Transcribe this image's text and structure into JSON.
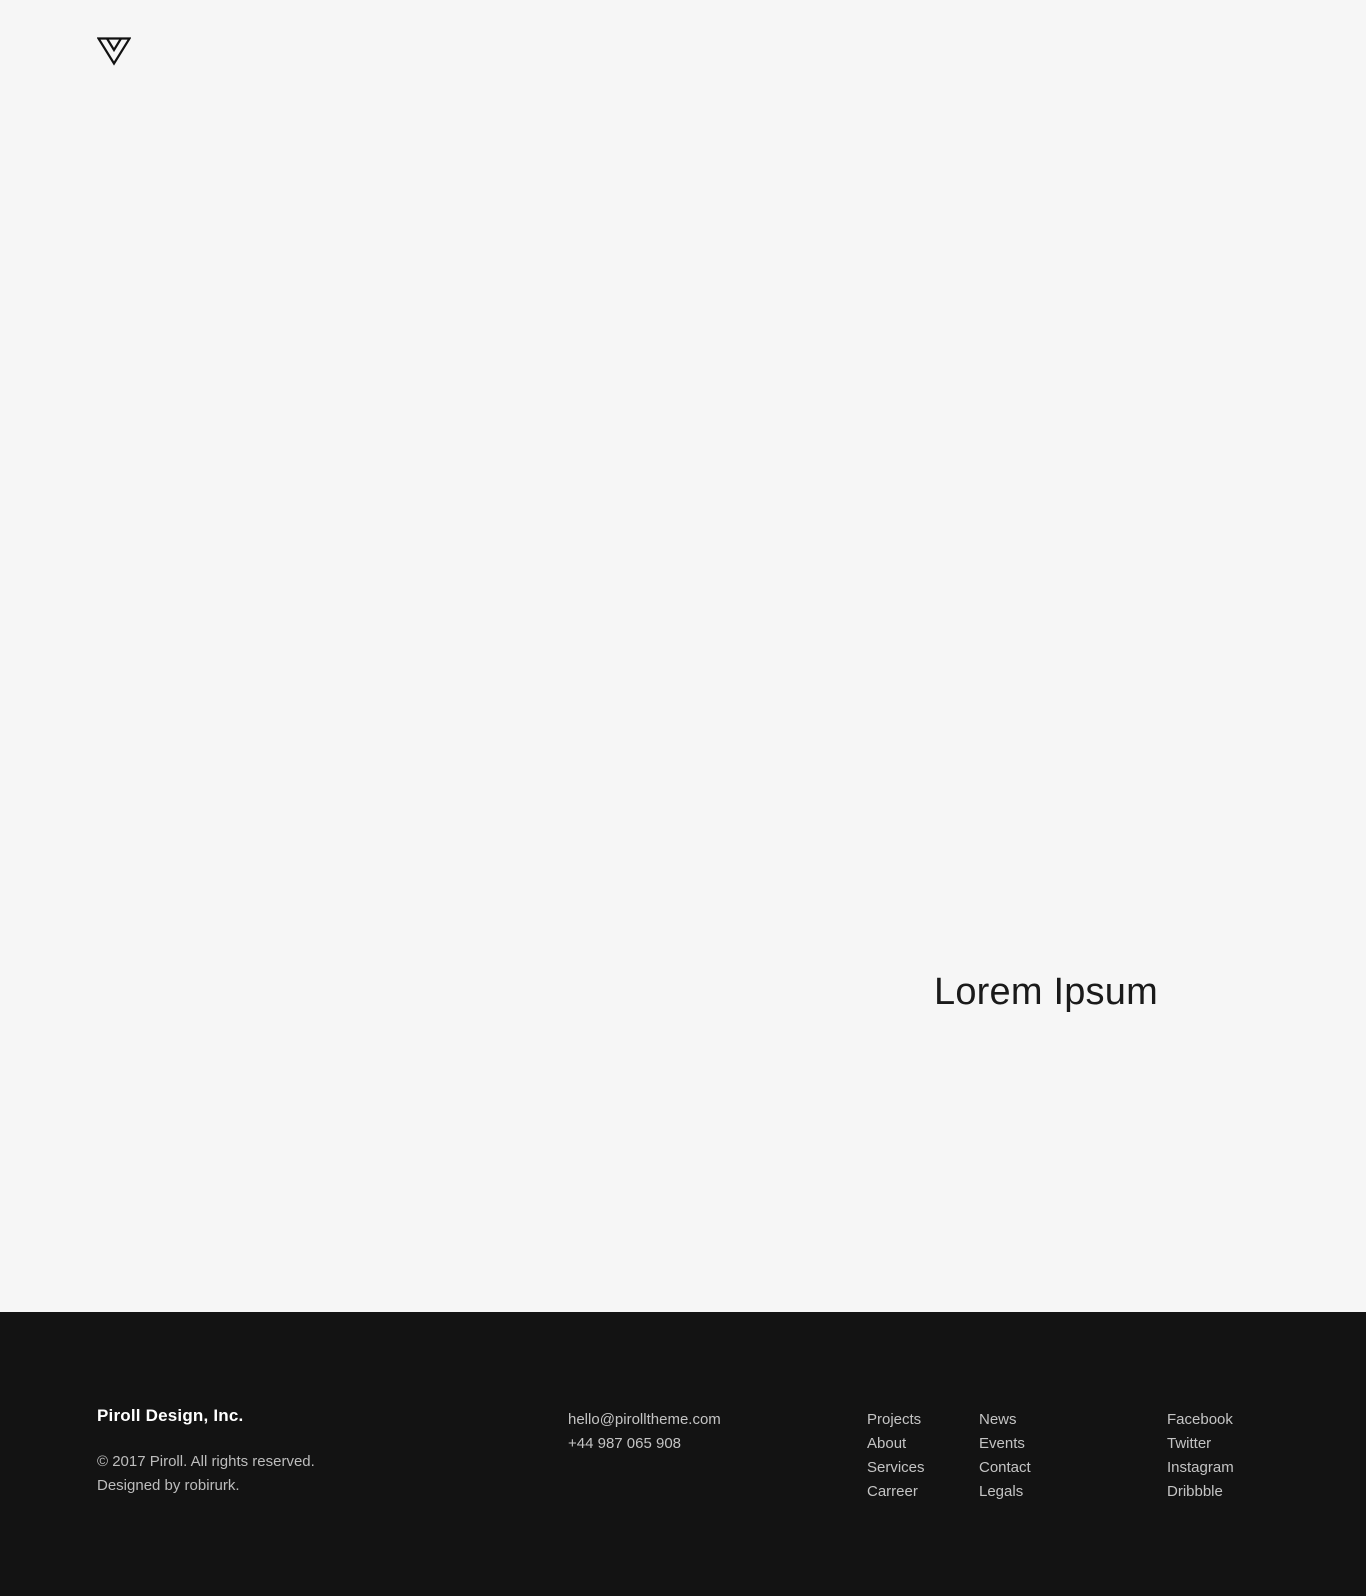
{
  "header": {
    "logo_icon": "triangle-logo-icon"
  },
  "hero": {
    "title": "Lorem Ipsum",
    "background_color": "#f6f6f6",
    "title_color": "#1a1a1a"
  },
  "footer": {
    "background_color": "#131313",
    "company_name": "Piroll Design, Inc.",
    "copyright": "© 2017 Piroll. All rights reserved.",
    "designed_by": "Designed by robirurk.",
    "contact": {
      "email": "hello@pirolltheme.com",
      "phone": "+44 987 065 908"
    },
    "nav_col1": [
      {
        "label": "Projects"
      },
      {
        "label": "About"
      },
      {
        "label": "Services"
      },
      {
        "label": "Carreer"
      }
    ],
    "nav_col2": [
      {
        "label": "News"
      },
      {
        "label": "Events"
      },
      {
        "label": "Contact"
      },
      {
        "label": "Legals"
      }
    ],
    "social": [
      {
        "label": "Facebook"
      },
      {
        "label": "Twitter"
      },
      {
        "label": "Instagram"
      },
      {
        "label": "Dribbble"
      }
    ]
  }
}
